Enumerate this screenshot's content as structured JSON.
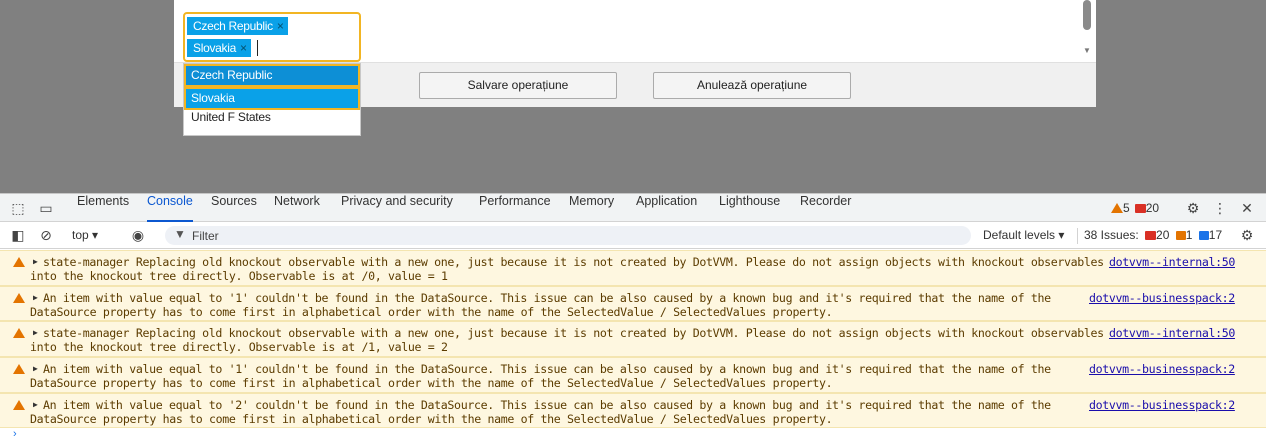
{
  "page": {
    "multiselect": {
      "selected_tags": [
        "Czech Republic",
        "Slovakia"
      ],
      "remove_glyph": "×",
      "options": [
        "Czech Republic",
        "Slovakia",
        "United F States"
      ]
    },
    "buttons": {
      "save_label": "Salvare operațiune",
      "cancel_label": "Anulează operațiune"
    }
  },
  "devtools": {
    "tabs": [
      "Elements",
      "Console",
      "Sources",
      "Network",
      "Privacy and security",
      "Performance",
      "Memory",
      "Application",
      "Lighthouse",
      "Recorder"
    ],
    "active_tab": "Console",
    "warning_count": "5",
    "error_count": "20",
    "toolbar": {
      "context": "top ▾",
      "filter_placeholder": "Filter",
      "levels": "Default levels ▾",
      "issues_label": "38 Issues:",
      "issues_errors": "20",
      "issues_warnings": "1",
      "issues_info": "17"
    },
    "messages": [
      {
        "line1": "state-manager Replacing old knockout observable with a new one, just because it is not created by DotVVM. Please do not assign objects with knockout observables",
        "line2": "into the knockout tree directly. Observable is at /0, value = 1",
        "source": "dotvvm--internal:50"
      },
      {
        "line1": "An item with value equal to '1' couldn't be found in the DataSource. This issue can be also caused by a known bug and it's required that the name of the",
        "line2": "DataSource property has to come first in alphabetical order with the name of the SelectedValue / SelectedValues property.",
        "source": "dotvvm--businesspack:2"
      },
      {
        "line1": "state-manager Replacing old knockout observable with a new one, just because it is not created by DotVVM. Please do not assign objects with knockout observables",
        "line2": "into the knockout tree directly. Observable is at /1, value = 2",
        "source": "dotvvm--internal:50"
      },
      {
        "line1": "An item with value equal to '1' couldn't be found in the DataSource. This issue can be also caused by a known bug and it's required that the name of the",
        "line2": "DataSource property has to come first in alphabetical order with the name of the SelectedValue / SelectedValues property.",
        "source": "dotvvm--businesspack:2"
      },
      {
        "line1": "An item with value equal to '2' couldn't be found in the DataSource. This issue can be also caused by a known bug and it's required that the name of the",
        "line2": "DataSource property has to come first in alphabetical order with the name of the SelectedValue / SelectedValues property.",
        "source": "dotvvm--businesspack:2"
      }
    ],
    "prompt_glyph": "›"
  }
}
